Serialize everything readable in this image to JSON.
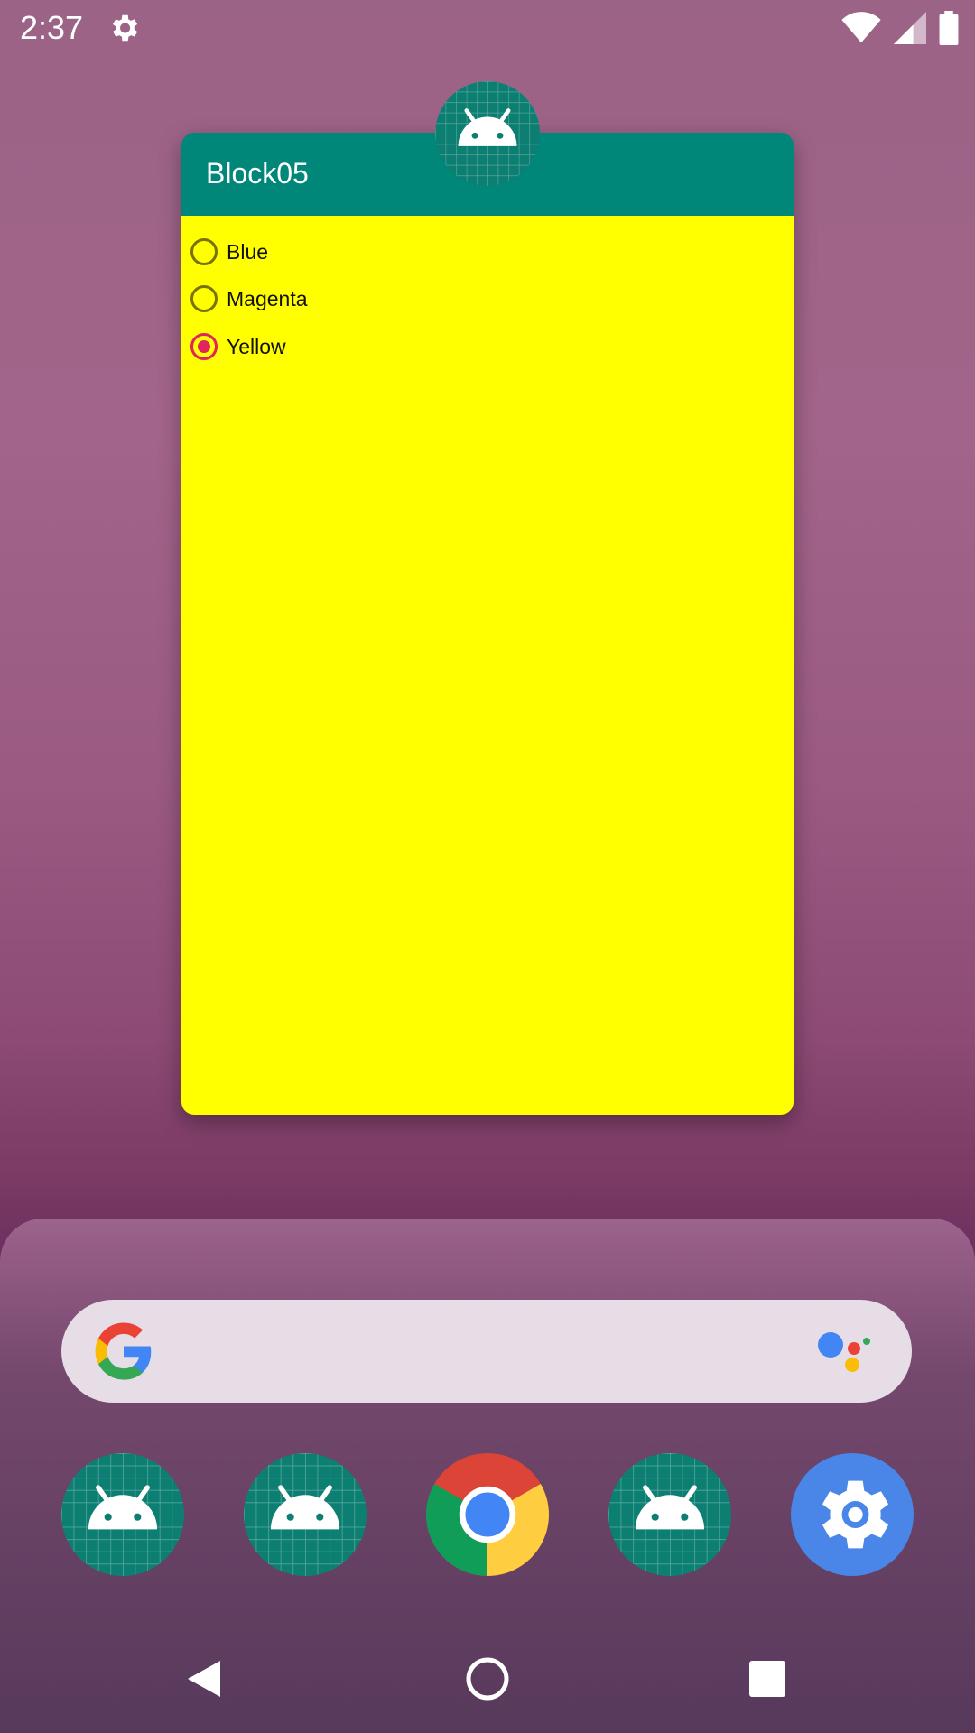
{
  "status_bar": {
    "time": "2:37"
  },
  "app_window": {
    "title": "Block05",
    "content_bg": "#ffff00",
    "appbar_bg": "#00877a",
    "options": [
      {
        "label": "Blue",
        "selected": false
      },
      {
        "label": "Magenta",
        "selected": false
      },
      {
        "label": "Yellow",
        "selected": true
      }
    ]
  },
  "search": {
    "left_icon": "google-g-icon",
    "right_icon": "assistant-icon"
  },
  "dock": [
    {
      "icon": "android-app-icon"
    },
    {
      "icon": "android-app-icon"
    },
    {
      "icon": "chrome-icon"
    },
    {
      "icon": "android-app-icon"
    },
    {
      "icon": "settings-app-icon"
    }
  ],
  "nav": {
    "back": "back-icon",
    "home": "home-icon",
    "recents": "recents-icon"
  }
}
